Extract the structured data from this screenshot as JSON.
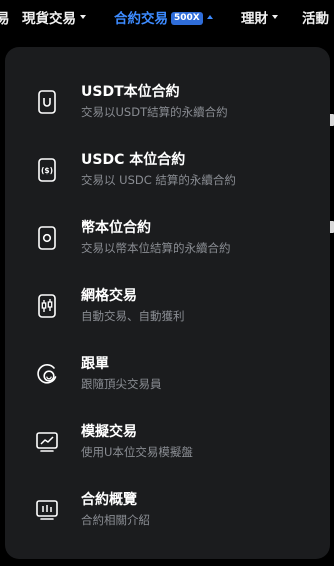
{
  "nav": {
    "items": [
      {
        "label": "易",
        "has_caret": false,
        "active": false
      },
      {
        "label": "現貨交易",
        "has_caret": true,
        "active": false
      },
      {
        "label": "合約交易",
        "has_caret": true,
        "active": true,
        "badge": "500X"
      },
      {
        "label": "理財",
        "has_caret": true,
        "active": false
      },
      {
        "label": "活動",
        "has_caret": false,
        "active": false
      }
    ],
    "active_color": "#3d8bff"
  },
  "menu": {
    "items": [
      {
        "title": "USDT本位合約",
        "subtitle": "交易以USDT結算的永續合約",
        "icon": "usdt-contract-icon"
      },
      {
        "title": "USDC 本位合約",
        "subtitle": "交易以 USDC 結算的永續合約",
        "icon": "usdc-contract-icon"
      },
      {
        "title": "幣本位合約",
        "subtitle": "交易以幣本位結算的永續合約",
        "icon": "coin-contract-icon"
      },
      {
        "title": "網格交易",
        "subtitle": "自動交易、自動獲利",
        "icon": "grid-trading-icon"
      },
      {
        "title": "跟單",
        "subtitle": "跟隨頂尖交易員",
        "icon": "copy-trading-icon"
      },
      {
        "title": "模擬交易",
        "subtitle": "使用U本位交易模擬盤",
        "icon": "demo-trading-icon"
      },
      {
        "title": "合約概覽",
        "subtitle": "合約相關介紹",
        "icon": "contract-overview-icon"
      }
    ]
  }
}
